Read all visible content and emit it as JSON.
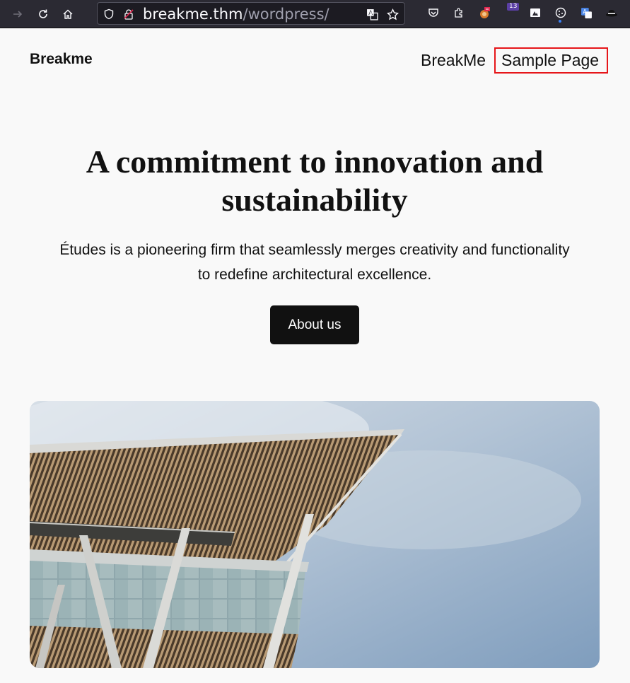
{
  "browser": {
    "url_host": "breakme.thm",
    "url_path": "/wordpress/",
    "extension_badge": "13",
    "icons": [
      "forward-icon",
      "reload-icon",
      "home-icon",
      "shield-icon",
      "lock-icon",
      "translate-icon",
      "bookmark-star-icon",
      "pocket-icon",
      "extensions-icon",
      "foxyproxy-icon",
      "hackbar-icon",
      "cookie-icon",
      "translate-ext-icon",
      "hat-icon"
    ]
  },
  "header": {
    "site_title": "Breakme",
    "nav": [
      {
        "label": "BreakMe"
      },
      {
        "label": "Sample Page"
      }
    ]
  },
  "hero": {
    "title": "A commitment to innovation and sustainability",
    "text": "Études is a pioneering firm that seamlessly merges creativity and functionality to redefine architectural excellence.",
    "button_label": "About us"
  },
  "colors": {
    "highlight": "#e6161a",
    "button_bg": "#111111",
    "page_bg": "#f9f9f9"
  }
}
